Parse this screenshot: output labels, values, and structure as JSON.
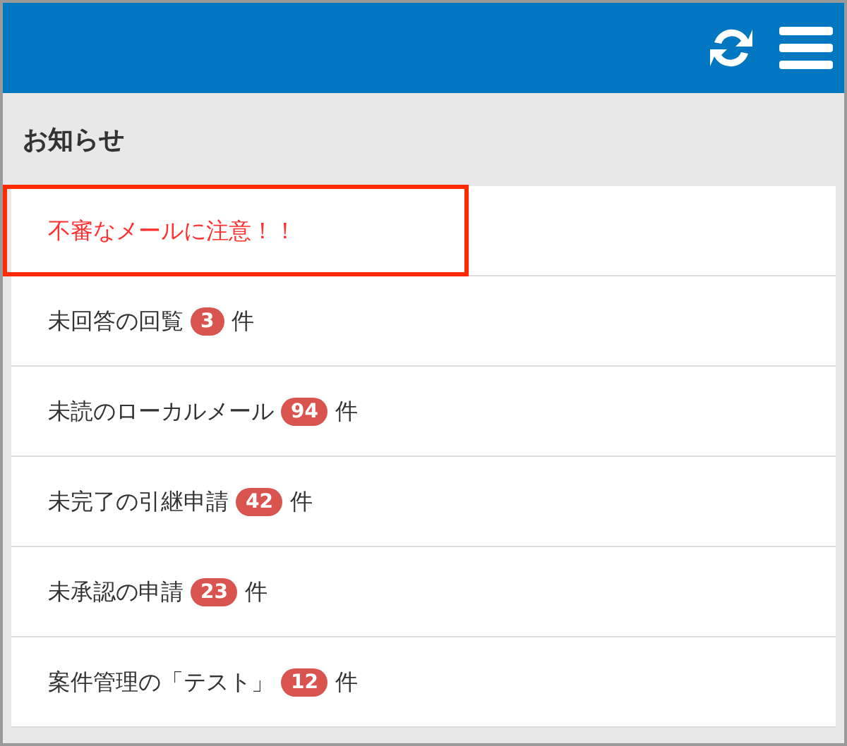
{
  "section": {
    "title": "お知らせ"
  },
  "items": [
    {
      "kind": "alert",
      "text": "不審なメールに注意！！",
      "highlighted": true
    },
    {
      "kind": "count",
      "text": "未回答の回覧",
      "count": "3",
      "unit": "件",
      "highlighted": false
    },
    {
      "kind": "count",
      "text": "未読のローカルメール",
      "count": "94",
      "unit": "件",
      "highlighted": false
    },
    {
      "kind": "count",
      "text": "未完了の引継申請",
      "count": "42",
      "unit": "件",
      "highlighted": false
    },
    {
      "kind": "count",
      "text": "未承認の申請",
      "count": "23",
      "unit": "件",
      "highlighted": false
    },
    {
      "kind": "count",
      "text": "案件管理の「テスト」",
      "count": "12",
      "unit": "件",
      "highlighted": false
    }
  ]
}
